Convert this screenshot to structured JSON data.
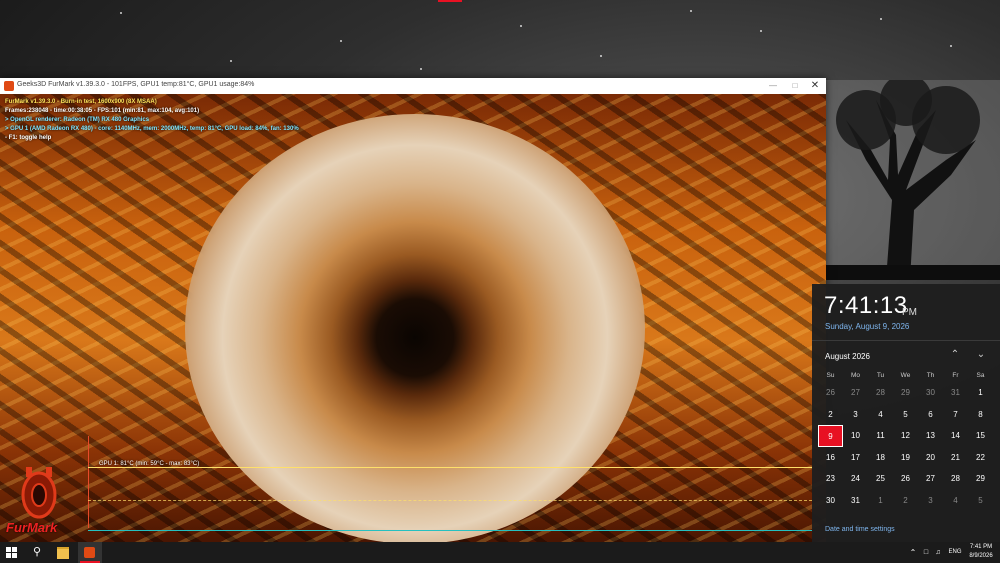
{
  "furmark": {
    "window_title": "Geeks3D FurMark v1.39.3.0 - 101FPS, GPU1 temp:81°C, GPU1 usage:84%",
    "overlay": {
      "line1": "FurMark v1.39.3.0 - Burn-in test, 1600x900 (8X MSAA)",
      "line2": "Frames:238048 - time:00:38:05 - FPS:101 (min:81, max:104, avg:101)",
      "line3": "> OpenGL renderer: Radeon (TM) RX 480 Graphics",
      "line4": "> GPU 1 (AMD Radeon RX 480) - core: 1140MHz, mem: 2000MHz, temp: 81°C, GPU load: 84%, fan: 130%",
      "line5": "- F1: toggle help"
    },
    "graph_label": "GPU 1: 81°C (min: 59°C - max: 83°C)",
    "logo_text": "FurMark"
  },
  "clock_flyout": {
    "time": "7:41:13",
    "ampm": "PM",
    "date": "Sunday, August 9, 2026",
    "month": "August 2026",
    "weekdays": [
      "Su",
      "Mo",
      "Tu",
      "We",
      "Th",
      "Fr",
      "Sa"
    ],
    "weeks": [
      [
        "26",
        "27",
        "28",
        "29",
        "30",
        "31",
        "1"
      ],
      [
        "2",
        "3",
        "4",
        "5",
        "6",
        "7",
        "8"
      ],
      [
        "9",
        "10",
        "11",
        "12",
        "13",
        "14",
        "15"
      ],
      [
        "16",
        "17",
        "18",
        "19",
        "20",
        "21",
        "22"
      ],
      [
        "23",
        "24",
        "25",
        "26",
        "27",
        "28",
        "29"
      ],
      [
        "30",
        "31",
        "1",
        "2",
        "3",
        "4",
        "5"
      ]
    ],
    "today": "9",
    "settings_link": "Date and time settings"
  },
  "taskbar": {
    "lang": "ENG",
    "time": "7:41 PM",
    "date": "8/9/2026"
  },
  "colors": {
    "accent": "#e81123",
    "link": "#7fb6ee",
    "taskbar": "#1b1b1b",
    "flyout": "#1e1e1e"
  }
}
